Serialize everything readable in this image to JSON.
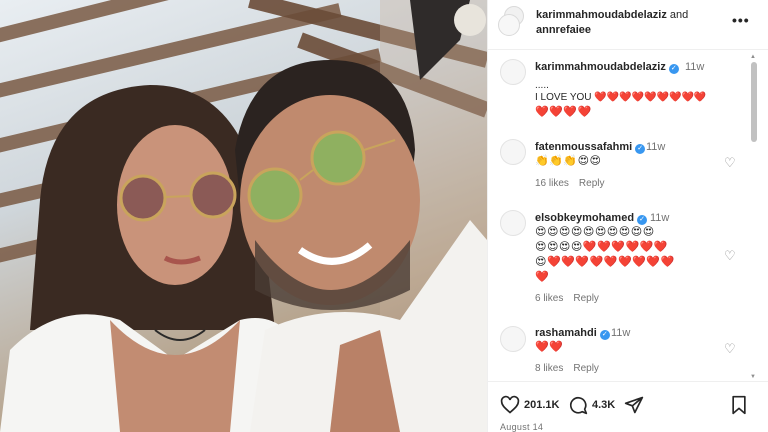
{
  "post": {
    "photo_description_icon": "couple-selfie-image"
  },
  "header": {
    "user1": "karimmahmoudabdelaziz",
    "and_text": "and",
    "user2": "annrefaiee",
    "more_icon": "more-icon",
    "more_label": "•••"
  },
  "comments": [
    {
      "username": "karimmahmoudabdelaziz",
      "time": "11w",
      "text_line1": ".....",
      "text_line2": "I LOVE YOU ❤️❤️❤️❤️❤️❤️❤️❤️❤️",
      "text_line3": "❤️❤️❤️❤️"
    },
    {
      "username": "fatenmoussafahmi",
      "time": "11w",
      "emojis": "👏👏👏😍😍",
      "likes": "16 likes",
      "reply": "Reply"
    },
    {
      "username": "elsobkeymohamed",
      "time": "11w",
      "emojis_line1": "😍😍😍😍😍😍😍😍😍😍",
      "emojis_line2": "😍😍😍😍❤️❤️❤️❤️❤️❤️",
      "emojis_line3": "😍❤️❤️❤️❤️❤️❤️❤️❤️❤️",
      "emojis_line4": "❤️",
      "likes": "6 likes",
      "reply": "Reply"
    },
    {
      "username": "rashamahdi",
      "time": "11w",
      "emojis": "❤️❤️",
      "likes": "8 likes",
      "reply": "Reply"
    }
  ],
  "actions": {
    "likes_count": "201.1K",
    "comments_count": "4.3K",
    "date": "August 14"
  },
  "colors": {
    "verified": "#3897f0",
    "text": "#262626",
    "muted": "#737373"
  }
}
